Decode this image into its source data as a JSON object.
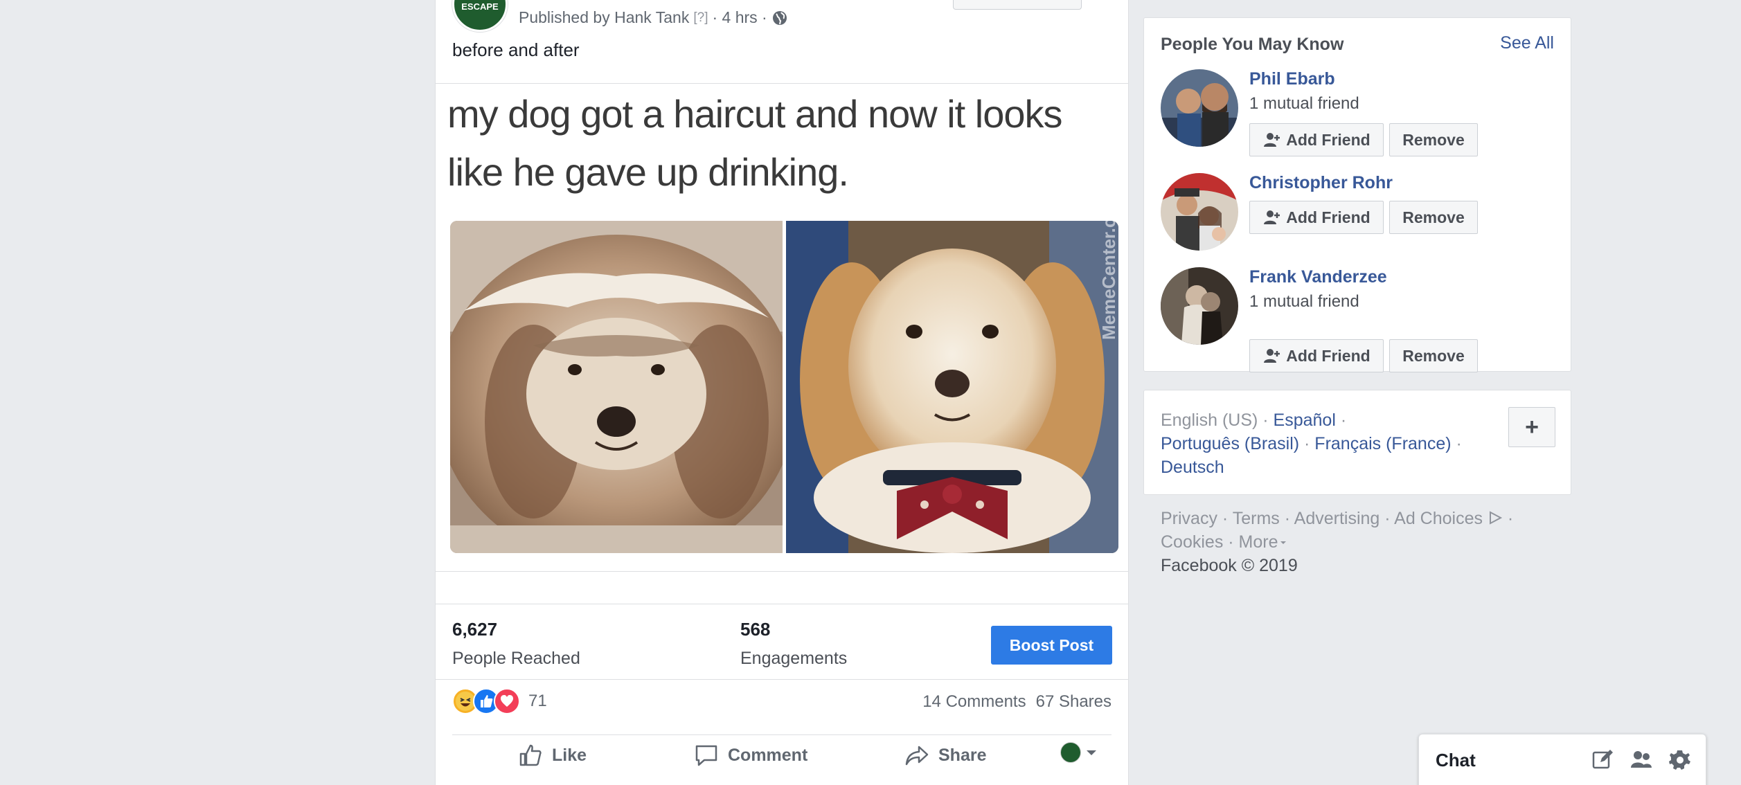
{
  "post": {
    "page_avatar_text": "JUNKIES ESCAPE",
    "published_by": "Published by Hank Tank",
    "help_marker": "[?]",
    "time": "· 4 hrs ·",
    "caption": "before and after",
    "meme_text": "my dog got a haircut and now it looks like he gave up drinking.",
    "watermark": "MemeCenter.com",
    "insights": {
      "reach_value": "6,627",
      "reach_label": "People Reached",
      "engagements_value": "568",
      "engagements_label": "Engagements",
      "boost_label": "Boost Post"
    },
    "reaction_count": "71",
    "comments": "14 Comments",
    "shares": "67 Shares",
    "actions": {
      "like": "Like",
      "comment": "Comment",
      "share": "Share"
    }
  },
  "pymk": {
    "title": "People You May Know",
    "see_all": "See All",
    "add_label": "Add Friend",
    "remove_label": "Remove",
    "people": [
      {
        "name": "Phil Ebarb",
        "mutual": "1 mutual friend"
      },
      {
        "name": "Christopher Rohr",
        "mutual": ""
      },
      {
        "name": "Frank Vanderzee",
        "mutual": "1 mutual friend"
      }
    ]
  },
  "languages": {
    "current": "English (US)",
    "espanol": "Español",
    "portugues": "Português (Brasil)",
    "francais": "Français (France)",
    "deutsch": "Deutsch",
    "plus": "+"
  },
  "footer": {
    "privacy": "Privacy",
    "terms": "Terms",
    "advertising": "Advertising",
    "ad_choices": "Ad Choices",
    "cookies": "Cookies",
    "more": "More",
    "copyright": "Facebook © 2019"
  },
  "chat": {
    "label": "Chat"
  },
  "colors": {
    "link": "#385898",
    "boost": "#2d7be5",
    "page_green": "#1f5c2e"
  },
  "icons": [
    "globe-icon",
    "haha-icon",
    "like-reaction-icon",
    "love-icon",
    "thumbs-up-icon",
    "comment-icon",
    "share-icon",
    "chevron-down-icon",
    "add-friend-icon",
    "ad-choices-icon",
    "new-message-icon",
    "create-group-icon",
    "gear-icon"
  ]
}
